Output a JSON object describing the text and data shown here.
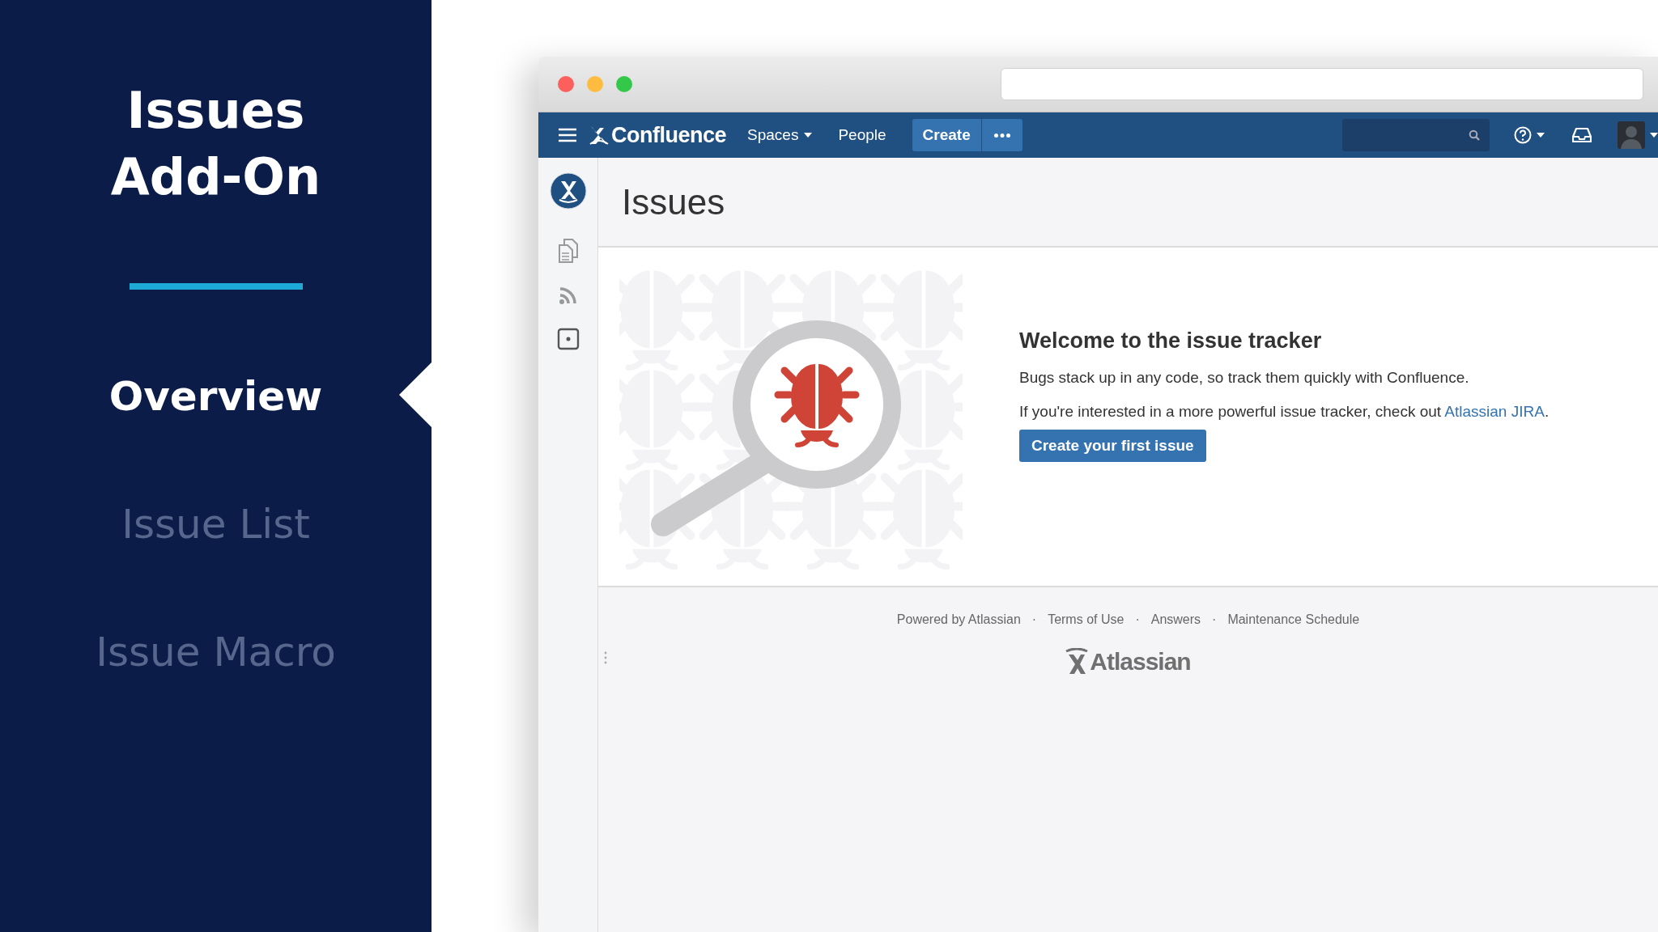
{
  "slide": {
    "title_lines": [
      "Issues",
      "Add-On"
    ],
    "nav": [
      {
        "label": "Overview",
        "selected": true
      },
      {
        "label": "Issue List",
        "selected": false
      },
      {
        "label": "Issue Macro",
        "selected": false
      }
    ]
  },
  "browser": {
    "topbar": {
      "logo": "Confluence",
      "items": [
        {
          "label": "Spaces",
          "has_menu": true
        },
        {
          "label": "People",
          "has_menu": false
        }
      ],
      "create": "Create"
    },
    "page": {
      "title": "Issues"
    },
    "welcome": {
      "heading": "Welcome to the issue tracker",
      "text": "Bugs stack up in any code, so track them quickly with Confluence.",
      "text_before": "If you're interested in a more powerful issue tracker, check out ",
      "link": "Atlassian JIRA",
      "text_after": ".",
      "button": "Create your first issue"
    },
    "footer": {
      "links": [
        "Powered by Atlassian",
        "Terms of Use",
        "Answers",
        "Maintenance Schedule"
      ],
      "separator": "·",
      "logo": "Atlassian"
    }
  }
}
